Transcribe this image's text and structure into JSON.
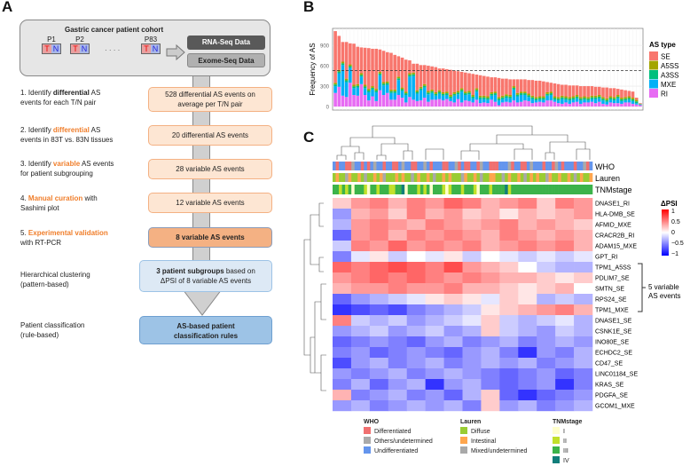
{
  "panel_a": {
    "label": "A",
    "cohort": {
      "title": "Gastric cancer patient cohort",
      "patients": [
        "P1",
        "P2",
        "P83"
      ],
      "tumor": "T",
      "normal": "N",
      "ellipsis": "· · · ·",
      "rna": "RNA-Seq Data",
      "exome": "Exome-Seq Data"
    },
    "steps": [
      {
        "pre": "1. Identify ",
        "em": "differential",
        "post": " AS",
        "line2": "events for each T/N pair",
        "em_color": "black",
        "result": "528 differential AS events on average per T/N pair"
      },
      {
        "pre": "2. Identify ",
        "em": "differential",
        "post": " AS",
        "line2": "events in 83T vs. 83N tissues",
        "em_color": "orange",
        "result": "20 differential AS events"
      },
      {
        "pre": "3. Identify ",
        "em": "variable",
        "post": " AS events",
        "line2": "for patient subgrouping",
        "em_color": "orange",
        "result": "28 variable AS events"
      },
      {
        "pre": "4. ",
        "em": "Manual curation",
        "post": " with",
        "line2": "Sashimi plot",
        "em_color": "orange",
        "result": "12 variable AS events"
      },
      {
        "pre": "5. ",
        "em": "Experimental validation",
        "post": "",
        "line2": "with RT-PCR",
        "em_color": "orange",
        "result": "8 variable AS events"
      }
    ],
    "clustering": {
      "line1": "Hierarchical clustering",
      "line2": "(pattern-based)",
      "result_bold": "3 patient subgroups",
      "result_rest": " based on",
      "result_line2": "ΔPSI of 8 variable AS events"
    },
    "classification": {
      "line1": "Patient classification",
      "line2": "(rule-based)",
      "result_line1": "AS-based patient",
      "result_line2": "classification rules"
    }
  },
  "chart_data": {
    "label": "B",
    "type": "bar",
    "stacked": true,
    "ylabel": "Frequency of AS",
    "xlabel": "",
    "yticks": [
      0,
      300,
      600,
      900
    ],
    "ylim": [
      0,
      1150
    ],
    "grid": true,
    "reference_line": 528,
    "legend": {
      "title": "AS type",
      "position": "right"
    },
    "series": [
      {
        "name": "RI",
        "color": "#e76bf3",
        "values": [
          200,
          290,
          160,
          140,
          350,
          170,
          160,
          330,
          170,
          90,
          150,
          80,
          240,
          170,
          200,
          100,
          100,
          170,
          130,
          60,
          140,
          100,
          80,
          90,
          130,
          70,
          100,
          100,
          110,
          90,
          110,
          80,
          60,
          110,
          60,
          90,
          80,
          60,
          100,
          50,
          60,
          50,
          100,
          70,
          20,
          60,
          70,
          60,
          90,
          60,
          70,
          90,
          80,
          50,
          60,
          70,
          60,
          90,
          90,
          70,
          50,
          40,
          60,
          40,
          60,
          70,
          40,
          60,
          60,
          70,
          50,
          70,
          40,
          30,
          60,
          50,
          50,
          40,
          60,
          60,
          40,
          30,
          20
        ]
      },
      {
        "name": "MXE",
        "color": "#00b0f6",
        "values": [
          100,
          200,
          450,
          220,
          220,
          100,
          120,
          110,
          100,
          120,
          100,
          130,
          220,
          140,
          120,
          100,
          100,
          220,
          100,
          110,
          300,
          350,
          110,
          150,
          150,
          110,
          100,
          60,
          80,
          70,
          60,
          40,
          100,
          70,
          160,
          80,
          100,
          60,
          120,
          60,
          50,
          50,
          60,
          100,
          70,
          50,
          60,
          60,
          160,
          90,
          100,
          80,
          60,
          60,
          30,
          30,
          40,
          70,
          80,
          30,
          40,
          70,
          40,
          50,
          40,
          50,
          50,
          40,
          30,
          40,
          60,
          50,
          50,
          40,
          40,
          40,
          70,
          40,
          30,
          40,
          40,
          20,
          10
        ]
      },
      {
        "name": "A3SS",
        "color": "#00bf7d",
        "values": [
          25,
          25,
          25,
          25,
          25,
          25,
          25,
          25,
          25,
          25,
          25,
          25,
          25,
          25,
          25,
          25,
          25,
          25,
          25,
          25,
          25,
          25,
          25,
          25,
          25,
          25,
          25,
          25,
          25,
          25,
          25,
          25,
          25,
          25,
          25,
          25,
          25,
          25,
          25,
          25,
          25,
          25,
          25,
          25,
          25,
          25,
          25,
          25,
          25,
          25,
          25,
          25,
          25,
          25,
          25,
          25,
          25,
          25,
          25,
          25,
          25,
          25,
          25,
          25,
          25,
          25,
          25,
          25,
          25,
          25,
          25,
          25,
          25,
          25,
          25,
          25,
          25,
          25,
          25,
          25,
          25,
          25,
          5
        ]
      },
      {
        "name": "A5SS",
        "color": "#a3a500",
        "values": [
          25,
          25,
          25,
          25,
          25,
          25,
          25,
          25,
          25,
          25,
          25,
          25,
          25,
          25,
          25,
          25,
          25,
          25,
          25,
          25,
          25,
          25,
          25,
          25,
          25,
          25,
          25,
          25,
          25,
          25,
          25,
          25,
          25,
          25,
          25,
          25,
          25,
          25,
          25,
          25,
          25,
          25,
          25,
          25,
          25,
          25,
          25,
          25,
          25,
          25,
          25,
          25,
          25,
          25,
          25,
          25,
          25,
          25,
          25,
          25,
          25,
          25,
          25,
          25,
          25,
          25,
          25,
          25,
          25,
          25,
          25,
          25,
          25,
          25,
          25,
          25,
          25,
          25,
          25,
          25,
          25,
          25,
          5
        ]
      },
      {
        "name": "SE",
        "color": "#f8766d",
        "values": [
          760,
          500,
          290,
          540,
          310,
          605,
          550,
          380,
          545,
          600,
          550,
          590,
          330,
          460,
          430,
          540,
          510,
          300,
          440,
          470,
          190,
          130,
          390,
          320,
          280,
          370,
          340,
          370,
          320,
          350,
          330,
          370,
          320,
          290,
          240,
          280,
          260,
          310,
          200,
          300,
          290,
          290,
          220,
          210,
          280,
          250,
          230,
          230,
          100,
          200,
          180,
          180,
          200,
          230,
          240,
          230,
          220,
          150,
          130,
          190,
          190,
          160,
          170,
          170,
          160,
          140,
          160,
          150,
          160,
          140,
          130,
          120,
          140,
          160,
          120,
          130,
          90,
          120,
          100,
          80,
          90,
          30,
          10
        ]
      }
    ]
  },
  "panel_c": {
    "label": "C",
    "track_labels": [
      "WHO",
      "Lauren",
      "TNMstage"
    ],
    "tracks": {
      "WHO": "UDUUDDOUUDUDUOUUDUUDDUOUUDDUUOUDUUUDDUUODUDDUUDOUUDDDUUUODUUDDUOUUUDUUDOUDUUUDUUODU",
      "Lauren": "DIDDMIDDIDMDDIDIMDDDIDIDDMDIDDIDMDDIDIDDDMIDDIDMDDIIDDMDIDDIDMDIDIDDMIDDIDDIDMDIDDI",
      "TNMstage": "33232313332133233322334133323231333212333233321333233334233333333333333333333333333"
    },
    "track_colors": {
      "WHO": {
        "D": "#f07070",
        "O": "#aaaaaa",
        "U": "#6495ed"
      },
      "Lauren": {
        "D": "#99cc33",
        "I": "#ffa64d",
        "M": "#a9a9a9"
      },
      "TNMstage": {
        "1": "#ffffcc",
        "2": "#c2e02a",
        "3": "#3cb34a",
        "4": "#117e7a"
      }
    },
    "rows": [
      {
        "name": "DNASE1_RI",
        "values": [
          0.2,
          0.4,
          0.5,
          0.3,
          0.5,
          0.4,
          0.6,
          0.5,
          0.3,
          0.4,
          0.5,
          0.2,
          0.5,
          0.4
        ]
      },
      {
        "name": "HLA-DMB_SE",
        "values": [
          -0.4,
          0.3,
          0.4,
          0.2,
          0.5,
          0.3,
          0.4,
          0.2,
          0.3,
          0.1,
          0.3,
          0.2,
          0.3,
          0.4
        ]
      },
      {
        "name": "AFMID_MXE",
        "values": [
          -0.3,
          0.4,
          0.5,
          0.4,
          0.3,
          0.5,
          0.4,
          0.3,
          0.4,
          0.5,
          0.3,
          0.4,
          0.3,
          0.2
        ]
      },
      {
        "name": "CRACR2B_RI",
        "values": [
          -0.6,
          0.4,
          0.5,
          0.3,
          0.5,
          0.4,
          0.5,
          0.4,
          0.3,
          0.5,
          0.4,
          0.3,
          0.4,
          0.3
        ]
      },
      {
        "name": "ADAM15_MXE",
        "values": [
          -0.2,
          0.5,
          0.4,
          0.6,
          0.4,
          0.5,
          0.4,
          0.5,
          0.3,
          0.4,
          0.5,
          0.4,
          0.5,
          0.3
        ]
      },
      {
        "name": "GPT_RI",
        "values": [
          -0.5,
          -0.1,
          0.1,
          -0.2,
          0,
          -0.1,
          0.1,
          -0.2,
          0,
          -0.1,
          -0.2,
          -0.1,
          -0.2,
          -0.1
        ]
      },
      {
        "name": "TPM1_A5SS",
        "values": [
          0.6,
          0.5,
          0.6,
          0.7,
          0.6,
          0.5,
          0.7,
          0.4,
          0.3,
          0.2,
          0,
          -0.2,
          -0.3,
          -0.3
        ]
      },
      {
        "name": "PDLIM7_SE",
        "values": [
          0.4,
          0.5,
          0.6,
          0.5,
          0.6,
          0.5,
          0.4,
          0.5,
          0.4,
          0.3,
          0.3,
          0.2,
          0.1,
          0.2
        ]
      },
      {
        "name": "SMTN_SE",
        "values": [
          0.3,
          0.4,
          0.4,
          0.5,
          0.4,
          0.4,
          0.5,
          0.3,
          0.3,
          0.2,
          0.1,
          0.2,
          0.3,
          0
        ]
      },
      {
        "name": "RPS24_SE",
        "values": [
          -0.6,
          -0.4,
          -0.3,
          -0.2,
          -0.1,
          0.1,
          0.2,
          0.1,
          -0.1,
          0.2,
          0.1,
          -0.3,
          -0.2,
          -0.3
        ]
      },
      {
        "name": "TPM1_MXE",
        "values": [
          -0.8,
          -0.7,
          -0.6,
          -0.7,
          -0.5,
          -0.4,
          -0.3,
          -0.2,
          0.1,
          0.2,
          0.3,
          0.4,
          0.5,
          0.3
        ]
      },
      {
        "name": "DNASE1_SE",
        "values": [
          0.5,
          -0.2,
          -0.3,
          -0.2,
          -0.4,
          -0.3,
          -0.2,
          -0.1,
          0.2,
          -0.2,
          -0.3,
          -0.2,
          -0.1,
          -0.3
        ]
      },
      {
        "name": "CSNK1E_SE",
        "values": [
          -0.4,
          -0.3,
          -0.2,
          -0.4,
          -0.3,
          -0.2,
          -0.4,
          -0.3,
          0.2,
          -0.2,
          -0.3,
          -0.4,
          -0.2,
          -0.3
        ]
      },
      {
        "name": "INO80E_SE",
        "values": [
          -0.6,
          -0.5,
          -0.4,
          -0.5,
          -0.6,
          -0.4,
          -0.3,
          -0.5,
          -0.4,
          -0.3,
          -0.5,
          -0.4,
          -0.3,
          -0.4
        ]
      },
      {
        "name": "ECHDC2_SE",
        "values": [
          -0.5,
          -0.4,
          -0.6,
          -0.5,
          -0.4,
          -0.5,
          -0.6,
          -0.4,
          -0.3,
          -0.5,
          -0.8,
          -0.4,
          -0.5,
          -0.3
        ]
      },
      {
        "name": "CD47_SE",
        "values": [
          -0.7,
          -0.4,
          -0.3,
          -0.5,
          -0.4,
          -0.3,
          -0.5,
          -0.4,
          -0.3,
          -0.4,
          -0.3,
          -0.5,
          -0.4,
          -0.3
        ]
      },
      {
        "name": "LINC01184_SE",
        "values": [
          -0.4,
          -0.5,
          -0.4,
          -0.3,
          -0.5,
          -0.4,
          -0.3,
          -0.4,
          -0.5,
          -0.6,
          -0.5,
          -0.4,
          -0.6,
          -0.5
        ]
      },
      {
        "name": "KRAS_SE",
        "values": [
          -0.5,
          -0.3,
          -0.6,
          -0.4,
          -0.3,
          -0.8,
          -0.4,
          -0.3,
          -0.5,
          -0.6,
          -0.5,
          -0.4,
          -0.8,
          -0.5
        ]
      },
      {
        "name": "PDGFA_SE",
        "values": [
          0.3,
          -0.5,
          -0.4,
          -0.3,
          -0.5,
          -0.4,
          -0.6,
          -0.3,
          0.2,
          -0.6,
          -0.8,
          -0.6,
          -0.5,
          -0.4
        ]
      },
      {
        "name": "GCOM1_MXE",
        "values": [
          -0.4,
          -0.3,
          -0.5,
          -0.4,
          -0.3,
          -0.4,
          -0.3,
          -0.5,
          0.2,
          -0.4,
          -0.3,
          -0.5,
          -0.4,
          -0.3
        ]
      }
    ],
    "bracket_label": [
      "5 variable",
      "AS events"
    ],
    "colorbar": {
      "title": "ΔPSI",
      "ticks": [
        "1",
        "0.5",
        "0",
        "−0.5",
        "−1"
      ],
      "high": "#ff0000",
      "mid": "#ffffff",
      "low": "#0000ff"
    },
    "legends": [
      {
        "title": "WHO",
        "items": [
          {
            "label": "Differentiated",
            "color": "#f07070"
          },
          {
            "label": "Others/undetermined",
            "color": "#aaaaaa"
          },
          {
            "label": "Undifferentiated",
            "color": "#6495ed"
          }
        ]
      },
      {
        "title": "Lauren",
        "items": [
          {
            "label": "Diffuse",
            "color": "#99cc33"
          },
          {
            "label": "Intestinal",
            "color": "#ffa64d"
          },
          {
            "label": "Mixed/undetermined",
            "color": "#a9a9a9"
          }
        ]
      },
      {
        "title": "TNMstage",
        "items": [
          {
            "label": "I",
            "color": "#ffffcc"
          },
          {
            "label": "II",
            "color": "#c2e02a"
          },
          {
            "label": "III",
            "color": "#3cb34a"
          },
          {
            "label": "IV",
            "color": "#117e7a"
          }
        ]
      }
    ]
  }
}
